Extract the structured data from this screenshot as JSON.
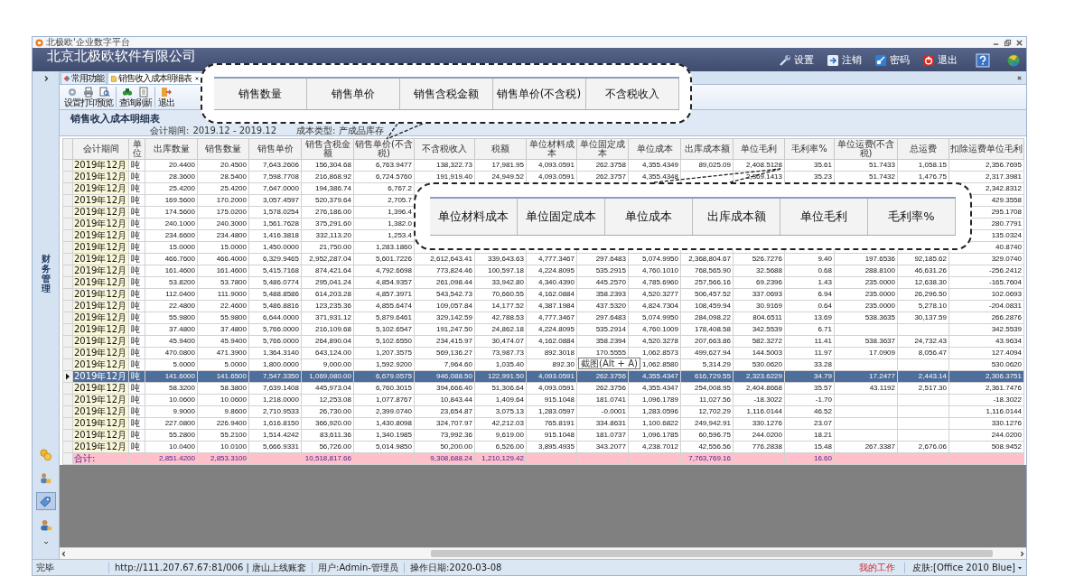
{
  "window": {
    "title": "北极欧'企业数字平台"
  },
  "banner": {
    "company": "北京北极欧软件有限公司",
    "actions": [
      {
        "label": "设置"
      },
      {
        "label": "注销"
      },
      {
        "label": "密码"
      },
      {
        "label": "退出"
      }
    ]
  },
  "tabs": [
    {
      "label": "常用功能",
      "selected": false,
      "closable": false
    },
    {
      "label": "销售收入成本明细表",
      "selected": true,
      "closable": true
    }
  ],
  "toolbar": [
    {
      "label": "设置",
      "separator_before": false
    },
    {
      "label": "打印",
      "separator_before": false
    },
    {
      "label": "预览",
      "separator_before": false
    },
    {
      "label": "查询",
      "separator_before": true
    },
    {
      "label": "刷新",
      "separator_before": false
    },
    {
      "label": "退出",
      "separator_before": true
    }
  ],
  "report": {
    "title": "销售收入成本明细表",
    "period_label": "会计期间:",
    "period": "2019.12 - 2019.12",
    "cost_type_label": "成本类型:",
    "cost_type": "产成品库存"
  },
  "sidebar": {
    "label": "财务管理",
    "items": [
      {
        "selected": false
      },
      {
        "selected": false
      },
      {
        "selected": true
      },
      {
        "selected": false
      }
    ]
  },
  "table": {
    "columns": [
      "会计期间",
      "单位",
      "出库数量",
      "销售数量",
      "销售单价",
      "销售含税金额",
      "销售单价(不含税)",
      "不含税收入",
      "税额",
      "单位材料成本",
      "单位固定成本",
      "单位成本",
      "出库成本额",
      "单位毛利",
      "毛利率%",
      "单位运费(不含税)",
      "总运费",
      "扣除运费单位毛利"
    ],
    "rows": [
      {
        "selected": false,
        "cells": [
          "2019年12月",
          "吨",
          "20.4400",
          "20.4500",
          "7,643.2606",
          "156,304.68",
          "6,763.9477",
          "138,322.73",
          "17,981.95",
          "4,093.0591",
          "262.3758",
          "4,355.4349",
          "89,025.09",
          "2,408.5128",
          "35.61",
          "51.7433",
          "1,058.15",
          "2,356.7695"
        ]
      },
      {
        "selected": false,
        "cells": [
          "2019年12月",
          "吨",
          "28.3600",
          "28.5400",
          "7,598.7708",
          "216,868.92",
          "6,724.5760",
          "191,919.40",
          "24,949.52",
          "4,093.0591",
          "262.3757",
          "4,355.4348",
          null,
          "2,369.1413",
          "35.23",
          "51.7432",
          "1,476.75",
          "2,317.3981"
        ]
      },
      {
        "selected": false,
        "cells": [
          "2019年12月",
          "吨",
          "25.4200",
          "25.4200",
          "7,647.0000",
          "194,386.74",
          "6,767.2",
          null,
          null,
          null,
          null,
          null,
          null,
          null,
          null,
          null,
          null,
          "2,342.8312"
        ]
      },
      {
        "selected": false,
        "cells": [
          "2019年12月",
          "吨",
          "169.5600",
          "170.2000",
          "3,057.4597",
          "520,379.64",
          "2,705.7",
          null,
          null,
          null,
          null,
          null,
          null,
          null,
          null,
          null,
          null,
          "429.3558"
        ]
      },
      {
        "selected": false,
        "cells": [
          "2019年12月",
          "吨",
          "174.5600",
          "175.0200",
          "1,578.0254",
          "276,186.00",
          "1,396.4",
          null,
          null,
          null,
          null,
          null,
          null,
          null,
          null,
          null,
          null,
          "295.1708"
        ]
      },
      {
        "selected": false,
        "cells": [
          "2019年12月",
          "吨",
          "240.1000",
          "240.3000",
          "1,561.7628",
          "375,291.60",
          "1,382.0",
          null,
          null,
          null,
          null,
          null,
          null,
          null,
          null,
          null,
          null,
          "280.7791"
        ]
      },
      {
        "selected": false,
        "cells": [
          "2019年12月",
          "吨",
          "234.6600",
          "234.4800",
          "1,416.3818",
          "332,113.20",
          "1,253.4",
          null,
          null,
          null,
          null,
          null,
          null,
          null,
          null,
          null,
          null,
          "135.0324"
        ]
      },
      {
        "selected": false,
        "cells": [
          "2019年12月",
          "吨",
          "15.0000",
          "15.0000",
          "1,450.0000",
          "21,750.00",
          "1,283.1860",
          null,
          null,
          null,
          null,
          null,
          null,
          null,
          null,
          null,
          null,
          "40.8740"
        ]
      },
      {
        "selected": false,
        "cells": [
          "2019年12月",
          "吨",
          "466.7600",
          "466.4000",
          "6,329.9465",
          "2,952,287.04",
          "5,601.7226",
          "2,612,643.41",
          "339,643.63",
          "4,777.3467",
          "297.6483",
          "5,074.9950",
          "2,368,804.67",
          "526.7276",
          "9.40",
          "197.6536",
          "92,185.62",
          "329.0740"
        ]
      },
      {
        "selected": false,
        "cells": [
          "2019年12月",
          "吨",
          "161.4600",
          "161.4600",
          "5,415.7168",
          "874,421.64",
          "4,792.6698",
          "773,824.46",
          "100,597.18",
          "4,224.8095",
          "535.2915",
          "4,760.1010",
          "768,565.90",
          "32.5688",
          "0.68",
          "288.8100",
          "46,631.26",
          "-256.2412"
        ]
      },
      {
        "selected": false,
        "cells": [
          "2019年12月",
          "吨",
          "53.8200",
          "53.7800",
          "5,486.0774",
          "295,041.24",
          "4,854.9357",
          "261,098.44",
          "33,942.80",
          "4,340.4390",
          "445.2570",
          "4,785.6960",
          "257,566.16",
          "69.2396",
          "1.43",
          "235.0000",
          "12,638.30",
          "-165.7604"
        ]
      },
      {
        "selected": false,
        "cells": [
          "2019年12月",
          "吨",
          "112.0400",
          "111.9000",
          "5,488.8586",
          "614,203.28",
          "4,857.3971",
          "543,542.73",
          "70,660.55",
          "4,162.0884",
          "358.2393",
          "4,520.3277",
          "506,457.52",
          "337.0693",
          "6.94",
          "235.0000",
          "26,296.50",
          "102.0693"
        ]
      },
      {
        "selected": false,
        "cells": [
          "2019年12月",
          "吨",
          "22.4800",
          "22.4600",
          "5,486.8816",
          "123,235.36",
          "4,855.6474",
          "109,057.84",
          "14,177.52",
          "4,387.1984",
          "437.5320",
          "4,824.7304",
          "108,459.94",
          "30.9169",
          "0.64",
          "235.0000",
          "5,278.10",
          "-204.0831"
        ]
      },
      {
        "selected": false,
        "cells": [
          "2019年12月",
          "吨",
          "55.9800",
          "55.9800",
          "6,644.0000",
          "371,931.12",
          "5,879.6461",
          "329,142.59",
          "42,788.53",
          "4,777.3467",
          "297.6483",
          "5,074.9950",
          "284,098.22",
          "804.6511",
          "13.69",
          "538.3635",
          "30,137.59",
          "266.2876"
        ]
      },
      {
        "selected": false,
        "cells": [
          "2019年12月",
          "吨",
          "37.4800",
          "37.4800",
          "5,766.0000",
          "216,109.68",
          "5,102.6547",
          "191,247.50",
          "24,862.18",
          "4,224.8095",
          "535.2914",
          "4,760.1009",
          "178,408.58",
          "342.5539",
          "6.71",
          null,
          null,
          "342.5539"
        ]
      },
      {
        "selected": false,
        "cells": [
          "2019年12月",
          "吨",
          "45.9400",
          "45.9400",
          "5,766.0000",
          "264,890.04",
          "5,102.6550",
          "234,415.97",
          "30,474.07",
          "4,162.0884",
          "358.2394",
          "4,520.3278",
          "207,663.86",
          "582.3272",
          "11.41",
          "538.3637",
          "24,732.43",
          "43.9634"
        ]
      },
      {
        "selected": false,
        "cells": [
          "2019年12月",
          "吨",
          "470.0800",
          "471.3900",
          "1,364.3140",
          "643,124.00",
          "1,207.3575",
          "569,136.27",
          "73,987.73",
          "892.3018",
          "170.5555",
          "1,062.8573",
          "499,627.94",
          "144.5003",
          "11.97",
          "17.0909",
          "8,056.47",
          "127.4094"
        ]
      },
      {
        "selected": false,
        "cells": [
          "2019年12月",
          "吨",
          "5.0000",
          "5.0000",
          "1,800.0000",
          "9,000.00",
          "1,592.9200",
          "7,964.60",
          "1,035.40",
          "892.30",
          null,
          "1,062.8580",
          "5,314.29",
          "530.0620",
          "33.28",
          null,
          null,
          "530.0620"
        ]
      },
      {
        "selected": true,
        "cells": [
          "2019年12月",
          "吨",
          "141.6000",
          "141.6500",
          "7,547.3350",
          "1,069,080.00",
          "6,679.0575",
          "946,088.50",
          "122,991.50",
          "4,093.0591",
          "262.3756",
          "4,355.4347",
          "616,729.55",
          "2,323.6229",
          "34.79",
          "17.2477",
          "2,443.14",
          "2,306.3751"
        ]
      },
      {
        "selected": false,
        "cells": [
          "2019年12月",
          "吨",
          "58.3200",
          "58.3800",
          "7,639.1408",
          "445,973.04",
          "6,760.3015",
          "394,666.40",
          "51,306.64",
          "4,093.0591",
          "262.3756",
          "4,355.4347",
          "254,008.95",
          "2,404.8668",
          "35.57",
          "43.1192",
          "2,517.30",
          "2,361.7476"
        ]
      },
      {
        "selected": false,
        "cells": [
          "2019年12月",
          "吨",
          "10.0600",
          "10.0600",
          "1,218.0000",
          "12,253.08",
          "1,077.8767",
          "10,843.44",
          "1,409.64",
          "915.1048",
          "181.0741",
          "1,096.1789",
          "11,027.56",
          "-18.3022",
          "-1.70",
          null,
          null,
          "-18.3022"
        ]
      },
      {
        "selected": false,
        "cells": [
          "2019年12月",
          "吨",
          "9.9000",
          "9.8600",
          "2,710.9533",
          "26,730.00",
          "2,399.0740",
          "23,654.87",
          "3,075.13",
          "1,283.0597",
          "-0.0001",
          "1,283.0596",
          "12,702.29",
          "1,116.0144",
          "46.52",
          null,
          null,
          "1,116.0144"
        ]
      },
      {
        "selected": false,
        "cells": [
          "2019年12月",
          "吨",
          "227.0800",
          "226.9400",
          "1,616.8150",
          "366,920.00",
          "1,430.8098",
          "324,707.97",
          "42,212.03",
          "765.8191",
          "334.8631",
          "1,100.6822",
          "249,942.91",
          "330.1276",
          "23.07",
          null,
          null,
          "330.1276"
        ]
      },
      {
        "selected": false,
        "cells": [
          "2019年12月",
          "吨",
          "55.2800",
          "55.2100",
          "1,514.4242",
          "83,611.36",
          "1,340.1985",
          "73,992.36",
          "9,619.00",
          "915.1048",
          "181.0737",
          "1,096.1785",
          "60,596.75",
          "244.0200",
          "18.21",
          null,
          null,
          "244.0200"
        ]
      },
      {
        "selected": false,
        "cells": [
          "2019年12月",
          "吨",
          "10.0400",
          "10.0100",
          "5,666.9331",
          "56,726.00",
          "5,014.9850",
          "50,200.00",
          "6,526.00",
          "3,895.4935",
          "343.2077",
          "4,238.7012",
          "42,556.56",
          "776.2838",
          "15.48",
          "267.3387",
          "2,676.06",
          "508.9452"
        ]
      }
    ],
    "total": {
      "cells": [
        "合计:",
        null,
        "2,851.4200",
        "2,853.3100",
        null,
        "10,518,817.66",
        null,
        "9,308,688.24",
        "1,210,129.42",
        null,
        null,
        null,
        "7,763,769.16",
        null,
        "16.60",
        null,
        null,
        null
      ]
    }
  },
  "tooltip": "截图(Alt + A)",
  "callouts": [
    {
      "cells": [
        "销售数量",
        "销售单价",
        "销售含税金额",
        "销售单价(不含税)",
        "不含税收入"
      ]
    },
    {
      "cells": [
        "单位材料成本",
        "单位固定成本",
        "单位成本",
        "出库成本额",
        "单位毛利",
        "毛利率%"
      ]
    }
  ],
  "status_bar": {
    "state": "完毕",
    "url": "http://111.207.67.67:81/006 | 唐山上线账套",
    "user": "用户:Admin-管理员",
    "date": "操作日期:2020-03-08",
    "work": "我的工作",
    "skin": "皮肤:[Office 2010 Blue]"
  }
}
